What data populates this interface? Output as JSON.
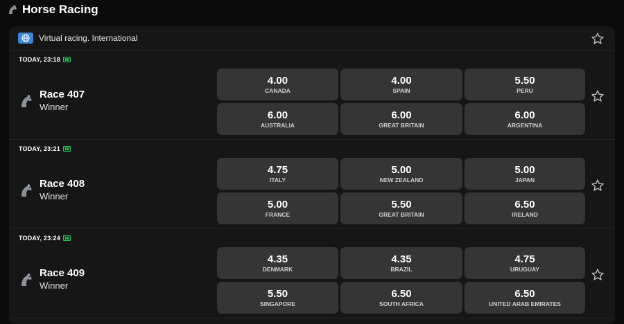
{
  "header": {
    "title": "Horse Racing",
    "icon": "horse-icon"
  },
  "panel": {
    "title": "Virtual racing. International",
    "icon": "globe-icon"
  },
  "races": [
    {
      "time": "TODAY, 23:18",
      "name": "Race 407",
      "market": "Winner",
      "odds": [
        {
          "value": "4.00",
          "label": "CANADA"
        },
        {
          "value": "4.00",
          "label": "SPAIN"
        },
        {
          "value": "5.50",
          "label": "PERU"
        },
        {
          "value": "6.00",
          "label": "AUSTRALIA"
        },
        {
          "value": "6.00",
          "label": "GREAT BRITAIN"
        },
        {
          "value": "6.00",
          "label": "ARGENTINA"
        }
      ]
    },
    {
      "time": "TODAY, 23:21",
      "name": "Race 408",
      "market": "Winner",
      "odds": [
        {
          "value": "4.75",
          "label": "ITALY"
        },
        {
          "value": "5.00",
          "label": "NEW ZEALAND"
        },
        {
          "value": "5.00",
          "label": "JAPAN"
        },
        {
          "value": "5.00",
          "label": "FRANCE"
        },
        {
          "value": "5.50",
          "label": "GREAT BRITAIN"
        },
        {
          "value": "6.50",
          "label": "IRELAND"
        }
      ]
    },
    {
      "time": "TODAY, 23:24",
      "name": "Race 409",
      "market": "Winner",
      "odds": [
        {
          "value": "4.35",
          "label": "DENMARK"
        },
        {
          "value": "4.35",
          "label": "BRAZIL"
        },
        {
          "value": "4.75",
          "label": "URUGUAY"
        },
        {
          "value": "5.50",
          "label": "SINGAPORE"
        },
        {
          "value": "6.50",
          "label": "SOUTH AFRICA"
        },
        {
          "value": "6.50",
          "label": "UNITED ARAB EMIRATES"
        }
      ]
    }
  ],
  "colors": {
    "background": "#0b0b0b",
    "panel": "#161616",
    "button": "#353535",
    "accent": "#3d86d6",
    "stream": "#2fc25b"
  }
}
